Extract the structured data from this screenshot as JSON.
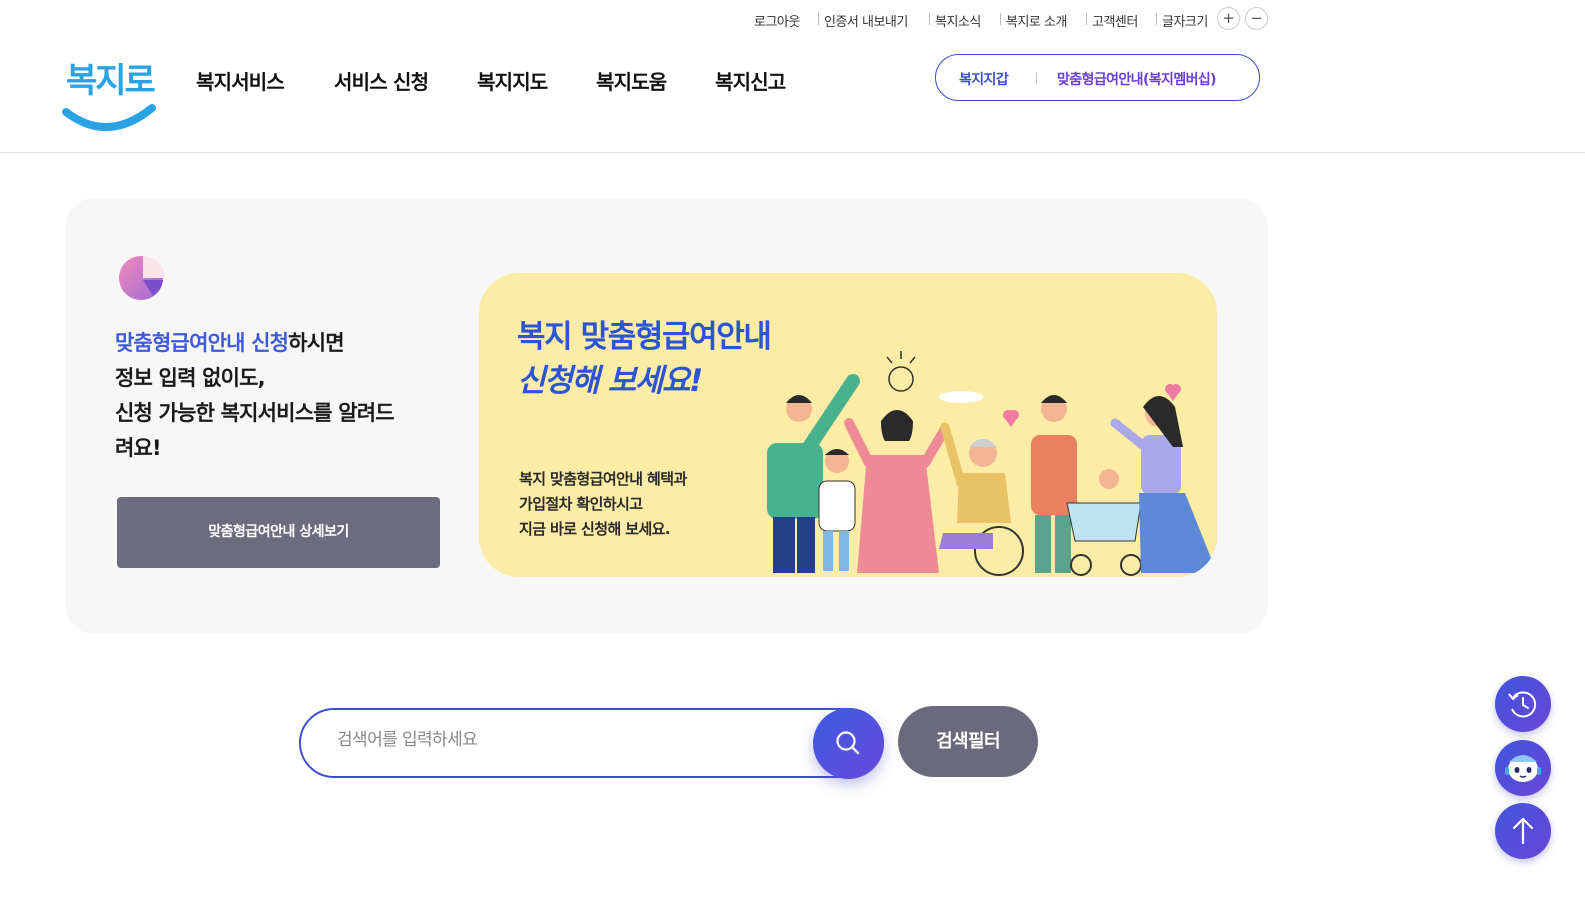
{
  "utility": {
    "logout": "로그아웃",
    "cert_export": "인증서 내보내기",
    "news": "복지소식",
    "about": "복지로 소개",
    "customer_center": "고객센터",
    "font_size": "글자크기",
    "font_plus": "+",
    "font_minus": "−"
  },
  "logo": {
    "text": "복지로"
  },
  "gnb": {
    "items": [
      "복지서비스",
      "서비스 신청",
      "복지지도",
      "복지도움",
      "복지신고"
    ]
  },
  "quick_links": {
    "wallet": "복지지갑",
    "membership": "맞춤형급여안내(복지멤버십)"
  },
  "promo": {
    "highlight": "맞춤형급여안내 신청",
    "line1_rest": "하시면",
    "line2": "정보 입력 없이도,",
    "line3": "신청 가능한 복지서비스를 알려드",
    "line4": "려요!",
    "detail_button": "맞춤형급여안내 상세보기"
  },
  "banner": {
    "title_line1": "복지 맞춤형급여안내",
    "title_line2": "신청해 보세요!",
    "sub_line1": "복지 맞춤형급여안내 혜택과",
    "sub_line2": "가입절차 확인하시고",
    "sub_line3": "지금 바로 신청해 보세요."
  },
  "search": {
    "placeholder": "검색어를 입력하세요",
    "value": "",
    "filter_label": "검색필터"
  },
  "colors": {
    "brand_blue": "#3d4fd0",
    "brand_purple": "#6b45d8",
    "banner_bg": "#fdeca5",
    "card_bg": "#f7f7f8",
    "button_gray": "#6a6a7c"
  },
  "icons": {
    "search": "search-icon",
    "history": "history-icon",
    "chatbot": "chatbot-icon",
    "top": "arrow-up-icon"
  }
}
